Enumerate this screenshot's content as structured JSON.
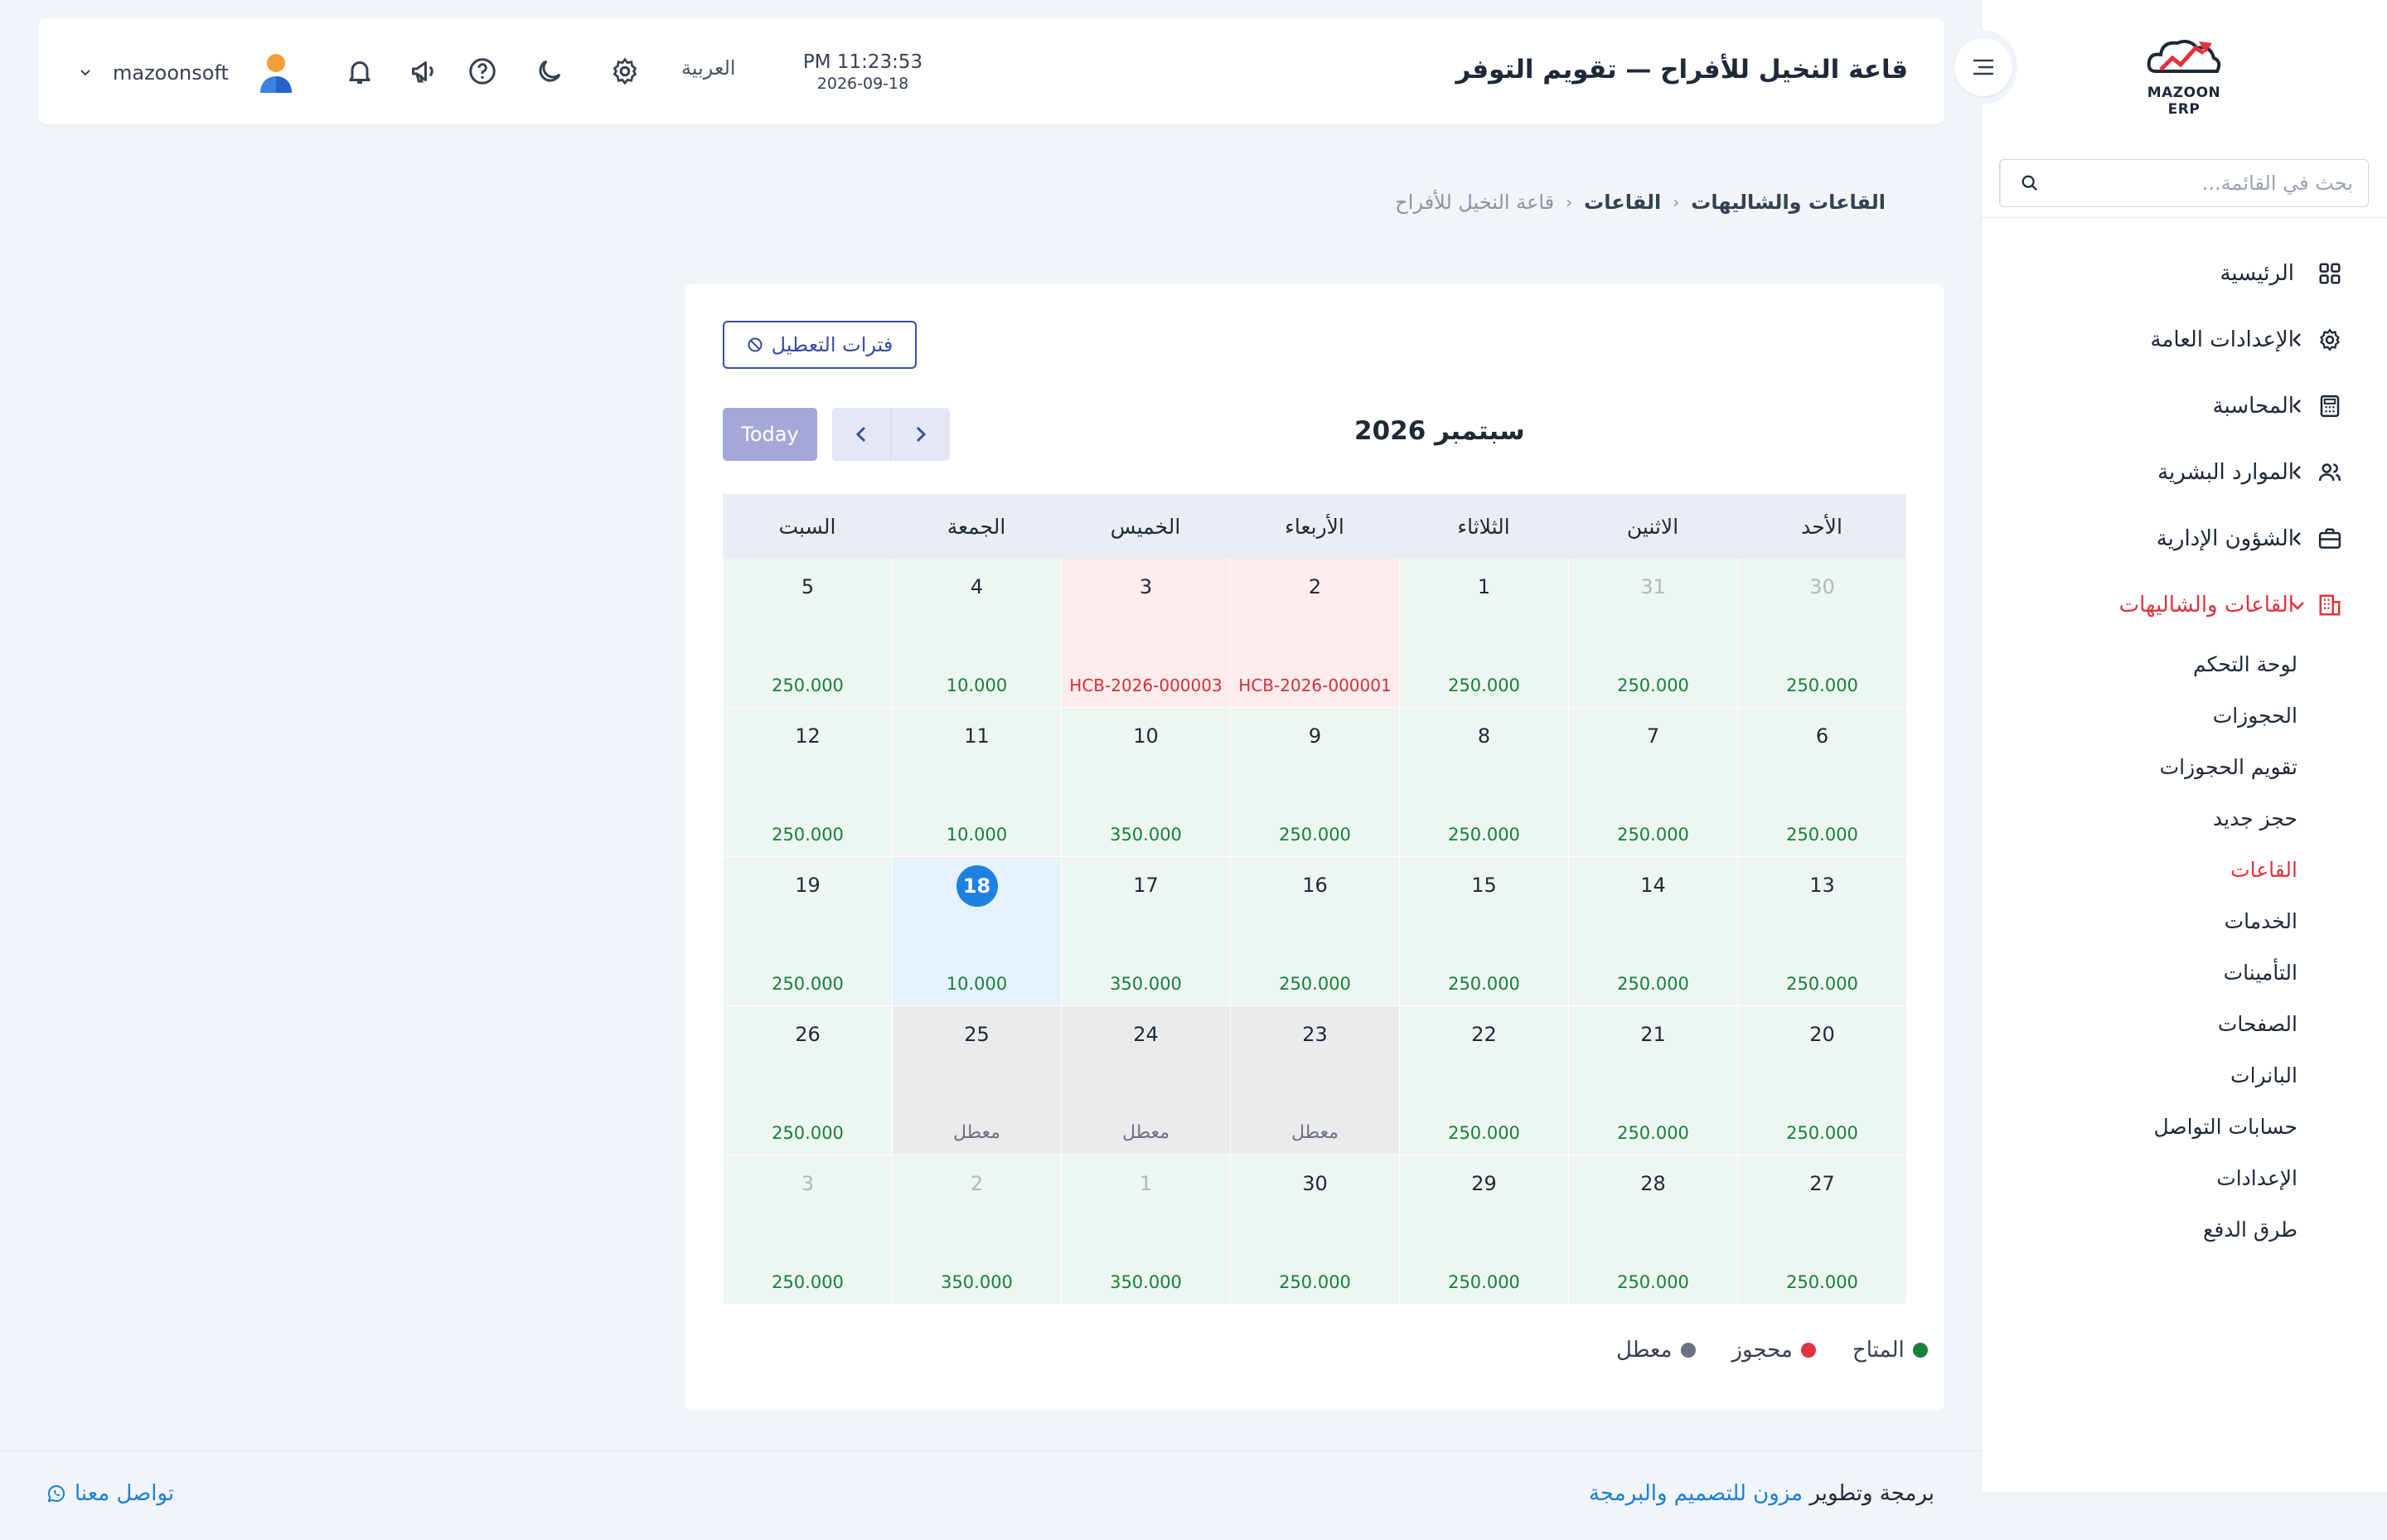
{
  "app": {
    "logo_text": "MAZOON ERP",
    "colors": {
      "accent": "#e0323f",
      "primary": "#3b4da0",
      "available": "#17803d",
      "booked": "#d32f3f",
      "disabled": "#6b7280",
      "today": "#1e80e0"
    }
  },
  "sidebar": {
    "search_placeholder": "بحث في القائمة...",
    "items": [
      {
        "label": "الرئيسية",
        "icon": "grid-icon"
      },
      {
        "label": "الإعدادات العامة",
        "icon": "gear-icon"
      },
      {
        "label": "المحاسبة",
        "icon": "calculator-icon"
      },
      {
        "label": "الموارد البشرية",
        "icon": "users-icon"
      },
      {
        "label": "الشؤون الإدارية",
        "icon": "briefcase-icon"
      },
      {
        "label": "القاعات والشاليهات",
        "icon": "building-icon"
      }
    ],
    "sub_items": [
      "لوحة التحكم",
      "الحجوزات",
      "تقويم الحجوزات",
      "حجز جديد",
      "القاعات",
      "الخدمات",
      "التأمينات",
      "الصفحات",
      "البانرات",
      "حسابات التواصل",
      "الإعدادات",
      "طرق الدفع"
    ]
  },
  "header": {
    "title": "قاعة النخيل للأفراح — تقويم التوفر",
    "time": "PM 11:23:53",
    "date": "2026-09-18",
    "language": "العربية",
    "username": "mazoonsoft"
  },
  "breadcrumb": [
    "القاعات والشاليهات",
    "القاعات",
    "قاعة النخيل للأفراح"
  ],
  "toolbar": {
    "downtime_label": "فترات التعطيل",
    "today_label": "Today",
    "month_title": "سبتمبر 2026"
  },
  "calendar": {
    "weekdays": [
      "الأحد",
      "الاثنين",
      "الثلاثاء",
      "الأربعاء",
      "الخميس",
      "الجمعة",
      "السبت"
    ],
    "cells": [
      {
        "day": "30",
        "value": "250.000",
        "status": "other"
      },
      {
        "day": "31",
        "value": "250.000",
        "status": "other"
      },
      {
        "day": "1",
        "value": "250.000",
        "status": "available"
      },
      {
        "day": "2",
        "value": "HCB-2026-000001",
        "status": "booked"
      },
      {
        "day": "3",
        "value": "HCB-2026-000003",
        "status": "booked"
      },
      {
        "day": "4",
        "value": "10.000",
        "status": "available"
      },
      {
        "day": "5",
        "value": "250.000",
        "status": "available"
      },
      {
        "day": "6",
        "value": "250.000",
        "status": "available"
      },
      {
        "day": "7",
        "value": "250.000",
        "status": "available"
      },
      {
        "day": "8",
        "value": "250.000",
        "status": "available"
      },
      {
        "day": "9",
        "value": "250.000",
        "status": "available"
      },
      {
        "day": "10",
        "value": "350.000",
        "status": "available"
      },
      {
        "day": "11",
        "value": "10.000",
        "status": "available"
      },
      {
        "day": "12",
        "value": "250.000",
        "status": "available"
      },
      {
        "day": "13",
        "value": "250.000",
        "status": "available"
      },
      {
        "day": "14",
        "value": "250.000",
        "status": "available"
      },
      {
        "day": "15",
        "value": "250.000",
        "status": "available"
      },
      {
        "day": "16",
        "value": "250.000",
        "status": "available"
      },
      {
        "day": "17",
        "value": "350.000",
        "status": "available"
      },
      {
        "day": "18",
        "value": "10.000",
        "status": "today"
      },
      {
        "day": "19",
        "value": "250.000",
        "status": "available"
      },
      {
        "day": "20",
        "value": "250.000",
        "status": "available"
      },
      {
        "day": "21",
        "value": "250.000",
        "status": "available"
      },
      {
        "day": "22",
        "value": "250.000",
        "status": "available"
      },
      {
        "day": "23",
        "value": "معطل",
        "status": "disabled"
      },
      {
        "day": "24",
        "value": "معطل",
        "status": "disabled"
      },
      {
        "day": "25",
        "value": "معطل",
        "status": "disabled"
      },
      {
        "day": "26",
        "value": "250.000",
        "status": "available"
      },
      {
        "day": "27",
        "value": "250.000",
        "status": "available"
      },
      {
        "day": "28",
        "value": "250.000",
        "status": "available"
      },
      {
        "day": "29",
        "value": "250.000",
        "status": "available"
      },
      {
        "day": "30",
        "value": "250.000",
        "status": "available"
      },
      {
        "day": "1",
        "value": "350.000",
        "status": "other"
      },
      {
        "day": "2",
        "value": "350.000",
        "status": "other"
      },
      {
        "day": "3",
        "value": "250.000",
        "status": "other"
      }
    ]
  },
  "legend": [
    {
      "label": "المتاح",
      "color": "#17803d"
    },
    {
      "label": "محجوز",
      "color": "#e0323f"
    },
    {
      "label": "معطل",
      "color": "#6b7280"
    }
  ],
  "footer": {
    "credit_prefix": "برمجة وتطوير",
    "credit_link": "مزون للتصميم والبرمجة",
    "contact": "تواصل معنا"
  }
}
